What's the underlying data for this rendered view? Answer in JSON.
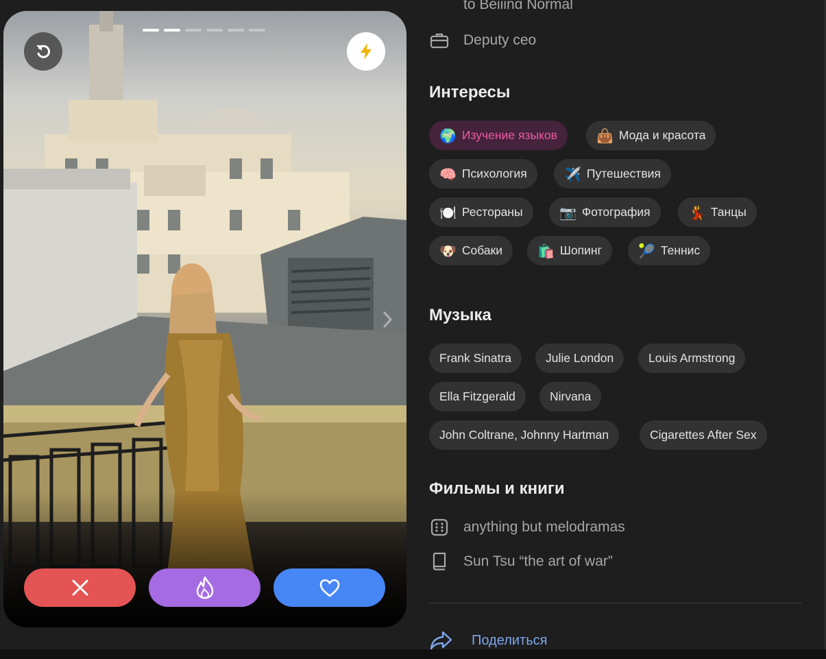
{
  "photo_card": {
    "progress": {
      "total": 6,
      "current": 2
    },
    "buttons": {
      "undo": "undo-icon",
      "boost": "lightning-icon",
      "next": "chevron-right-icon",
      "nope": "close-icon",
      "super_like": "flame-icon",
      "like": "heart-icon"
    },
    "colors": {
      "nope": "#e45454",
      "super_like": "#a46be2",
      "like": "#4786f5",
      "boost_icon": "#f1b300"
    }
  },
  "profile": {
    "timezone_partial": "to Beijing Normal",
    "job": "Deputy ceo",
    "interests": {
      "title": "Интересы",
      "items": [
        {
          "emoji": "🌍",
          "label": "Изучение языков",
          "selected": true
        },
        {
          "emoji": "👜",
          "label": "Мода и красота",
          "selected": false
        },
        {
          "emoji": "🧠",
          "label": "Психология",
          "selected": false
        },
        {
          "emoji": "✈️",
          "label": "Путешествия",
          "selected": false
        },
        {
          "emoji": "🍽️",
          "label": "Рестораны",
          "selected": false
        },
        {
          "emoji": "📷",
          "label": "Фотография",
          "selected": false
        },
        {
          "emoji": "💃",
          "label": "Танцы",
          "selected": false
        },
        {
          "emoji": "🐶",
          "label": "Собаки",
          "selected": false
        },
        {
          "emoji": "🛍️",
          "label": "Шопинг",
          "selected": false
        },
        {
          "emoji": "🎾",
          "label": "Теннис",
          "selected": false
        }
      ]
    },
    "music": {
      "title": "Музыка",
      "items": [
        "Frank Sinatra",
        "Julie London",
        "Louis Armstrong",
        "Ella Fitzgerald",
        "Nirvana",
        "John Coltrane, Johnny Hartman",
        "Cigarettes After Sex"
      ]
    },
    "films_books": {
      "title": "Фильмы и книги",
      "film": "anything but melodramas",
      "book": "Sun Tsu “the art of war”"
    },
    "share_label": "Поделиться",
    "accent_colors": {
      "selected_chip_text": "#ee5aa5",
      "selected_chip_bg": "#45233a",
      "share_link": "#7ea7ee"
    }
  }
}
